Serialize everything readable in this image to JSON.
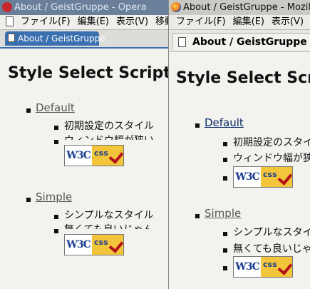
{
  "opera": {
    "title": "About / GeistGruppe - Opera",
    "menu": [
      "ファイル(F)",
      "編集(E)",
      "表示(V)",
      "移動"
    ],
    "tab_label": "About / GeistGruppe",
    "page_title": "Style Select Script",
    "styles": [
      {
        "name": "Default",
        "descs": [
          "初期設定のスタイル",
          "ウィンドウ幅が狭い"
        ]
      },
      {
        "name": "Simple",
        "descs": [
          "シンプルなスタイル",
          "無くても良いじゃん"
        ]
      }
    ]
  },
  "mozilla": {
    "title": "About / GeistGruppe - Mozilla",
    "menu": [
      "ファイル(F)",
      "編集(E)",
      "表示(V)"
    ],
    "tab_label": "About / GeistGruppe",
    "page_title": "Style Select Script",
    "styles": [
      {
        "name": "Default",
        "descs": [
          "初期設定のスタイル",
          "ウィンドウ幅が狭い"
        ]
      },
      {
        "name": "Simple",
        "descs": [
          "シンプルなスタイル",
          "無くても良いじゃん"
        ]
      }
    ]
  },
  "badge": {
    "w3c": "W3C",
    "css": "css"
  }
}
